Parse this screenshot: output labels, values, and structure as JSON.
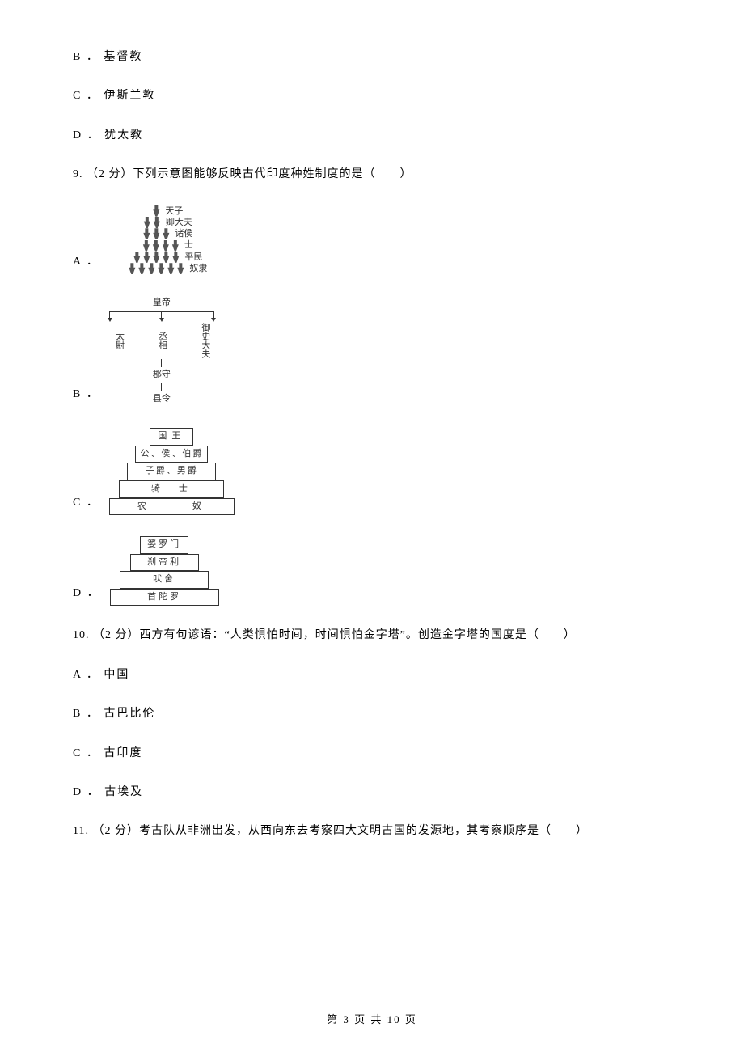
{
  "q8_options": {
    "b": "B ． 基督教",
    "c": "C ． 伊斯兰教",
    "d": "D ． 犹太教"
  },
  "q9": {
    "stem": "9.  （2 分）下列示意图能够反映古代印度种姓制度的是（　　）",
    "letters": {
      "a": "A ．",
      "b": "B ．",
      "c": "C ．",
      "d": "D ．"
    },
    "diagram_a": {
      "labels": [
        "天子",
        "卿大夫",
        "诸侯",
        "士",
        "平民",
        "奴隶"
      ]
    },
    "diagram_b": {
      "top": "皇帝",
      "left": "太尉",
      "mid": "丞相",
      "right": "御史大夫",
      "down1": "郡守",
      "down2": "县令"
    },
    "diagram_c": {
      "levels": [
        "国王",
        "公、侯、伯爵",
        "子爵、男爵",
        "骑　士",
        "农　　　奴"
      ]
    },
    "diagram_d": {
      "levels": [
        "婆罗门",
        "刹帝利",
        "吠舍",
        "首陀罗"
      ]
    }
  },
  "q10": {
    "stem": "10.  （2 分）西方有句谚语：“人类惧怕时间，时间惧怕金字塔”。创造金字塔的国度是（　　）",
    "a": "A ． 中国",
    "b": "B ． 古巴比伦",
    "c": "C ． 古印度",
    "d": "D ． 古埃及"
  },
  "q11": {
    "stem": "11.  （2 分）考古队从非洲出发，从西向东去考察四大文明古国的发源地，其考察顺序是（　　）"
  },
  "footer": "第 3 页 共 10 页"
}
